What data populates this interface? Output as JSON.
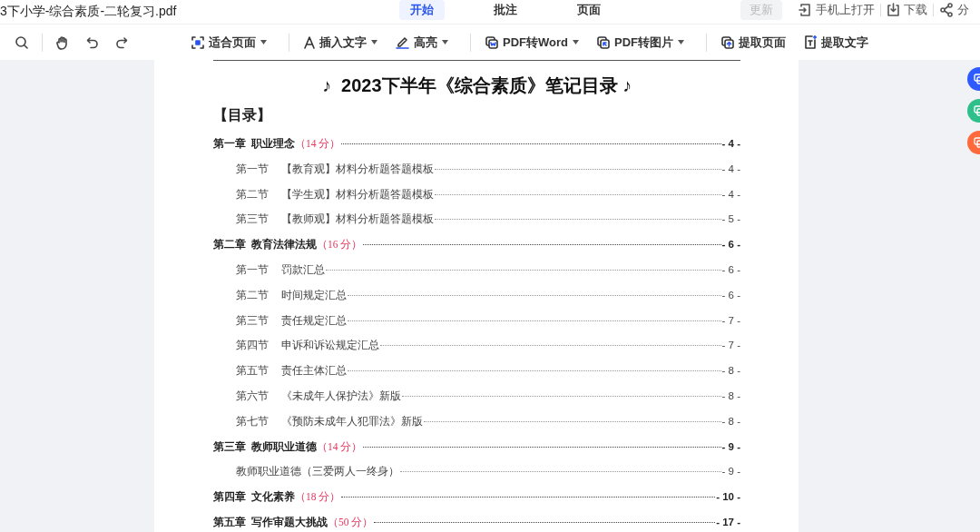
{
  "title_bar": {
    "file_name": "3下小学-综合素质-二轮复习.pdf",
    "tabs": [
      {
        "label": "开始",
        "selected": true
      },
      {
        "label": "批注",
        "selected": false
      },
      {
        "label": "页面",
        "selected": false
      }
    ],
    "update_button": {
      "label": "更新",
      "disabled": true
    },
    "actions": [
      {
        "kind": "phone",
        "label": "手机上打开"
      },
      {
        "kind": "download",
        "label": "下载"
      },
      {
        "kind": "share",
        "label": "分"
      }
    ]
  },
  "toolbar": {
    "tools": [
      {
        "kind": "search"
      },
      {
        "kind": "hand"
      },
      {
        "kind": "undo"
      },
      {
        "kind": "redo"
      }
    ],
    "buttons": [
      {
        "kind": "fit",
        "label": "适合页面",
        "dropdown": true
      },
      {
        "kind": "text",
        "label": "插入文字",
        "dropdown": true
      },
      {
        "kind": "highlight",
        "label": "高亮",
        "dropdown": true
      },
      {
        "kind": "word",
        "label": "PDF转Word",
        "dropdown": true
      },
      {
        "kind": "image",
        "label": "PDF转图片",
        "dropdown": true
      },
      {
        "kind": "extract-page",
        "label": "提取页面",
        "dropdown": false
      },
      {
        "kind": "extract-text",
        "label": "提取文字",
        "dropdown": false
      }
    ]
  },
  "document": {
    "title": "♪  2023下半年《综合素质》笔记目录 ♪",
    "heading": "【目录】",
    "entries": [
      {
        "kind": "chapter",
        "label": "第一章",
        "title": "职业理念",
        "score": "（14 分）",
        "page": "- 4 -"
      },
      {
        "kind": "section",
        "label": "第一节",
        "title": "【教育观】材料分析题答题模板",
        "page": "- 4 -"
      },
      {
        "kind": "section",
        "label": "第二节",
        "title": "【学生观】材料分析题答题模板",
        "page": "- 4 -"
      },
      {
        "kind": "section",
        "label": "第三节",
        "title": "【教师观】材料分析题答题模板",
        "page": "- 5 -"
      },
      {
        "kind": "chapter",
        "label": "第二章",
        "title": "教育法律法规",
        "score": "（16 分）",
        "page": "- 6 -"
      },
      {
        "kind": "section",
        "label": "第一节",
        "title": "罚款汇总",
        "page": "- 6 -"
      },
      {
        "kind": "section",
        "label": "第二节",
        "title": "时间规定汇总",
        "page": "- 6 -"
      },
      {
        "kind": "section",
        "label": "第三节",
        "title": "责任规定汇总",
        "page": "- 7 -"
      },
      {
        "kind": "section",
        "label": "第四节",
        "title": "申诉和诉讼规定汇总",
        "page": "- 7 -"
      },
      {
        "kind": "section",
        "label": "第五节",
        "title": "责任主体汇总",
        "page": "- 8 -"
      },
      {
        "kind": "section",
        "label": "第六节",
        "title": "《未成年人保护法》新版",
        "page": "- 8 -"
      },
      {
        "kind": "section",
        "label": "第七节",
        "title": "《预防未成年人犯罪法》新版",
        "page": "- 8 -"
      },
      {
        "kind": "chapter",
        "label": "第三章",
        "title": "教师职业道德",
        "score": "（14 分）",
        "page": "- 9 -"
      },
      {
        "kind": "section",
        "title": "教师职业道德（三爱两人一终身）",
        "page": "- 9 -"
      },
      {
        "kind": "chapter",
        "label": "第四章",
        "title": "文化素养",
        "score": "（18 分）",
        "page": "- 10 -"
      },
      {
        "kind": "chapter",
        "label": "第五章",
        "title": "写作审题大挑战",
        "score": "（50 分）",
        "page": "- 17 -"
      }
    ]
  },
  "side_tools": [
    {
      "color": "#2d5bff"
    },
    {
      "color": "#2fbf8a"
    },
    {
      "color": "#ff6a3d"
    }
  ]
}
